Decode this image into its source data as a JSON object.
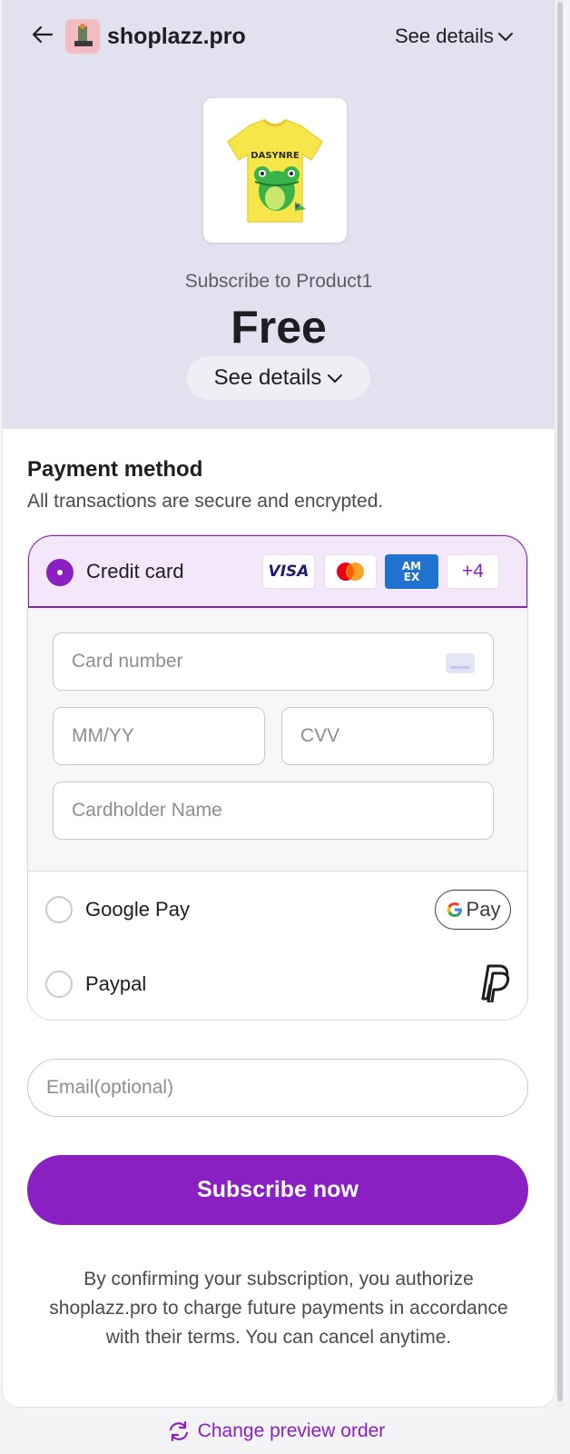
{
  "header": {
    "store_name": "shoplazz.pro",
    "see_details": "See details"
  },
  "product": {
    "subscribe_to": "Subscribe to Product1",
    "price": "Free",
    "see_details": "See details",
    "shirt_text": "DASYNRE"
  },
  "payment": {
    "title": "Payment method",
    "subtitle": "All transactions are secure and encrypted.",
    "methods": [
      {
        "label": "Credit card",
        "selected": true
      },
      {
        "label": "Google Pay",
        "selected": false
      },
      {
        "label": "Paypal",
        "selected": false
      }
    ],
    "card_brands": [
      "VISA",
      "Mastercard",
      "AMEX",
      "+4"
    ],
    "card_brand_more": "+4",
    "visa_label": "VISA",
    "amex_label_1": "AM",
    "amex_label_2": "EX",
    "gpay_badge_text": "Pay",
    "card_number_placeholder": "Card number",
    "expiry_placeholder": "MM/YY",
    "cvv_placeholder": "CVV",
    "cardholder_placeholder": "Cardholder Name"
  },
  "email_placeholder": "Email(optional)",
  "subscribe_button": "Subscribe now",
  "legal_text": "By confirming your subscription, you authorize shoplazz.pro to charge future payments in accordance with their terms. You can cancel anytime.",
  "change_preview_order": "Change preview order",
  "colors": {
    "accent": "#8a1fc2",
    "hero_bg": "#e1e1ef",
    "selected_bg": "#f3e7f9"
  },
  "icons": [
    "arrow-left-icon",
    "chevron-down-icon",
    "card-icon",
    "google-g-icon",
    "paypal-icon",
    "refresh-icon"
  ]
}
